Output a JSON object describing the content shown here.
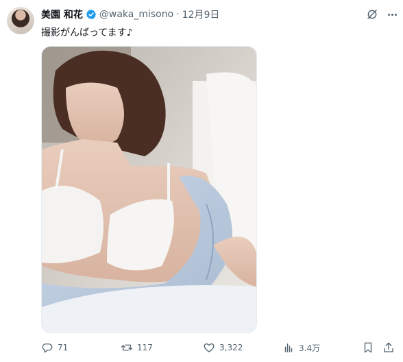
{
  "tweet": {
    "author_name": "美園 和花",
    "handle": "@waka_misono",
    "separator": "·",
    "date": "12月9日",
    "text": "撮影がんばってます♪",
    "verified_color": "#1d9bf0"
  },
  "actions": {
    "replies": "71",
    "reposts": "117",
    "likes": "3,322",
    "views": "3.4万"
  },
  "icons": [
    "grok-icon",
    "more-icon",
    "reply-icon",
    "repost-icon",
    "like-icon",
    "views-icon",
    "bookmark-icon",
    "share-icon"
  ]
}
